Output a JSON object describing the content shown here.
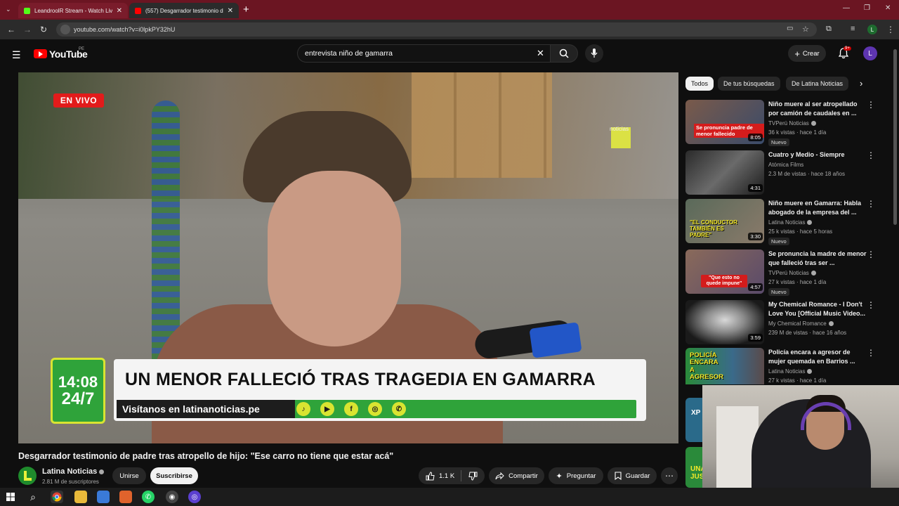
{
  "browser": {
    "tabs": [
      {
        "title": "LeandroolR Stream - Watch Liv",
        "favicon_color": "#53fc18"
      },
      {
        "title": "(557) Desgarrador testimonio d",
        "favicon_color": "#ff0000"
      }
    ],
    "url": "youtube.com/watch?v=i0lpkPY32hU",
    "profile_initial": "L"
  },
  "youtube": {
    "logo_text": "YouTube",
    "country": "PE",
    "search_query": "entrevista niño de gamarra",
    "create_label": "Crear",
    "notification_count": "9+",
    "avatar_initial": "L"
  },
  "video": {
    "live_label": "EN VIVO",
    "clock": "14:08",
    "clock_sub": "24/7",
    "headline": "UN MENOR FALLECIÓ TRAS TRAGEDIA EN GAMARRA",
    "site": "Visítanos en latinanoticias.pe",
    "watermark": "noticias",
    "title": "Desgarrador testimonio de padre tras atropello de hijo: \"Ese carro no tiene que estar acá\"",
    "channel": "Latina Noticias",
    "subscribers": "2.81 M de suscriptores",
    "join_label": "Unirse",
    "subscribe_label": "Suscribirse",
    "likes": "1.1 K",
    "share_label": "Compartir",
    "ask_label": "Preguntar",
    "save_label": "Guardar"
  },
  "chips": [
    "Todos",
    "De tus búsquedas",
    "De Latina Noticias"
  ],
  "recommendations": [
    {
      "title": "Niño muere al ser atropellado por camión de caudales en ...",
      "channel": "TVPerú Noticias",
      "meta": "36 k vistas · hace 1 día",
      "badge": "Nuevo",
      "duration": "8:05",
      "thumb_text": "Se pronuncia padre de menor fallecido",
      "verified": true
    },
    {
      "title": "Cuatro y Medio - Siempre",
      "channel": "Atómica Films",
      "meta": "2.3 M de vistas · hace 18 años",
      "badge": "",
      "duration": "4:31",
      "thumb_text": "",
      "verified": false
    },
    {
      "title": "Niño muere en Gamarra: Habla abogado de la empresa del ...",
      "channel": "Latina Noticias",
      "meta": "25 k vistas · hace 5 horas",
      "badge": "Nuevo",
      "duration": "3:30",
      "thumb_text": "\"EL CONDUCTOR TAMBIÉN ES PADRE\"",
      "verified": true
    },
    {
      "title": "Se pronuncia la madre de menor que falleció tras ser ...",
      "channel": "TVPerú Noticias",
      "meta": "27 k vistas · hace 1 día",
      "badge": "Nuevo",
      "duration": "4:57",
      "thumb_text": "\"Que esto no quede impune\"",
      "verified": true
    },
    {
      "title": "My Chemical Romance - I Don't Love You [Official Music Video...",
      "channel": "My Chemical Romance",
      "meta": "239 M de vistas · hace 16 años",
      "badge": "",
      "duration": "3:59",
      "thumb_text": "",
      "verified": true
    },
    {
      "title": "Policía encara a agresor de mujer quemada en Barrios ...",
      "channel": "Latina Noticias",
      "meta": "27 k vistas · hace 1 día",
      "badge": "",
      "duration": "",
      "thumb_text": "POLICÍA ENCARA A AGRESOR",
      "verified": true
    }
  ],
  "partial_thumbs": [
    "XP",
    "UNA JUS"
  ],
  "colors": {
    "accent_red": "#ff0000",
    "news_green": "#2fa33a",
    "news_yellow": "#d9e431",
    "live_red": "#e21b1b"
  }
}
